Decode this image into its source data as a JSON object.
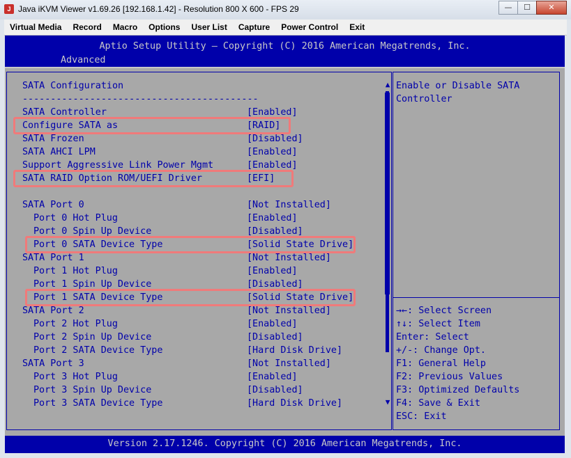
{
  "window": {
    "title": "Java iKVM Viewer v1.69.26 [192.168.1.42]  - Resolution 800 X 600 - FPS 29",
    "minimize": "—",
    "maximize": "☐",
    "close": "✕"
  },
  "menubar": [
    "Virtual Media",
    "Record",
    "Macro",
    "Options",
    "User List",
    "Capture",
    "Power Control",
    "Exit"
  ],
  "bios": {
    "header": "Aptio Setup Utility – Copyright (C) 2016 American Megatrends, Inc.",
    "active_tab": "Advanced",
    "section_title": "SATA Configuration",
    "separator": "------------------------------------------",
    "settings": [
      {
        "label": "SATA Controller",
        "value": "[Enabled]",
        "indent": false,
        "highlight": false
      },
      {
        "label": "Configure SATA as",
        "value": "[RAID]",
        "indent": false,
        "highlight": true
      },
      {
        "label": "SATA Frozen",
        "value": "[Disabled]",
        "indent": false,
        "highlight": false
      },
      {
        "label": "SATA AHCI LPM",
        "value": "[Enabled]",
        "indent": false,
        "highlight": false
      },
      {
        "label": "Support Aggressive Link Power Mgmt",
        "value": "[Enabled]",
        "indent": false,
        "highlight": false
      },
      {
        "label": "SATA RAID Option ROM/UEFI Driver",
        "value": "[EFI]",
        "indent": false,
        "highlight": true
      },
      {
        "label": "",
        "value": "",
        "indent": false,
        "highlight": false
      },
      {
        "label": "SATA Port 0",
        "value": "[Not Installed]",
        "indent": false,
        "highlight": false
      },
      {
        "label": "Port 0 Hot Plug",
        "value": "[Enabled]",
        "indent": true,
        "highlight": false
      },
      {
        "label": "Port 0 Spin Up Device",
        "value": "[Disabled]",
        "indent": true,
        "highlight": false
      },
      {
        "label": "Port 0 SATA Device Type",
        "value": "[Solid State Drive]",
        "indent": true,
        "highlight": true
      },
      {
        "label": "SATA Port 1",
        "value": "[Not Installed]",
        "indent": false,
        "highlight": false
      },
      {
        "label": "Port 1 Hot Plug",
        "value": "[Enabled]",
        "indent": true,
        "highlight": false
      },
      {
        "label": "Port 1 Spin Up Device",
        "value": "[Disabled]",
        "indent": true,
        "highlight": false
      },
      {
        "label": "Port 1 SATA Device Type",
        "value": "[Solid State Drive]",
        "indent": true,
        "highlight": true
      },
      {
        "label": "SATA Port 2",
        "value": "[Not Installed]",
        "indent": false,
        "highlight": false
      },
      {
        "label": "Port 2 Hot Plug",
        "value": "[Enabled]",
        "indent": true,
        "highlight": false
      },
      {
        "label": "Port 2 Spin Up Device",
        "value": "[Disabled]",
        "indent": true,
        "highlight": false
      },
      {
        "label": "Port 2 SATA Device Type",
        "value": "[Hard Disk Drive]",
        "indent": true,
        "highlight": false
      },
      {
        "label": "SATA Port 3",
        "value": "[Not Installed]",
        "indent": false,
        "highlight": false
      },
      {
        "label": "Port 3 Hot Plug",
        "value": "[Enabled]",
        "indent": true,
        "highlight": false
      },
      {
        "label": "Port 3 Spin Up Device",
        "value": "[Disabled]",
        "indent": true,
        "highlight": false
      },
      {
        "label": "Port 3 SATA Device Type",
        "value": "[Hard Disk Drive]",
        "indent": true,
        "highlight": false
      }
    ],
    "help_text": [
      "Enable or Disable SATA",
      "Controller"
    ],
    "key_help": [
      "→←: Select Screen",
      "↑↓: Select Item",
      "Enter: Select",
      "+/-: Change Opt.",
      "F1: General Help",
      "F2: Previous Values",
      "F3: Optimized Defaults",
      "F4: Save & Exit",
      "ESC: Exit"
    ],
    "scroll_up": "▲",
    "scroll_down": "▼",
    "footer": "Version 2.17.1246. Copyright (C) 2016 American Megatrends, Inc."
  },
  "colors": {
    "bios_blue": "#0000aa",
    "bios_gray": "#a8a8a8",
    "bios_light": "#c8c8c8",
    "highlight_box": "#f07a7a"
  }
}
